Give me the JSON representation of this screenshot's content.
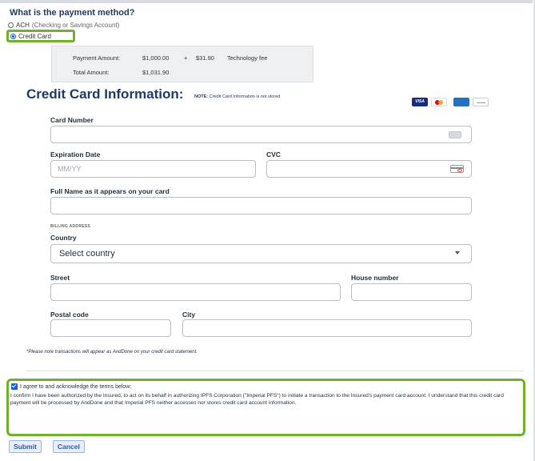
{
  "payment_method": {
    "question": "What is the payment method?",
    "ach_label": "ACH",
    "ach_sub": "(Checking or Savings Account)",
    "credit_card_label": "Credit Card",
    "selected": "Credit Card"
  },
  "payment_summary": {
    "payment_amount_label": "Payment Amount:",
    "payment_amount": "$1,000.00",
    "plus": "+",
    "fee_amount": "$31.90",
    "fee_label": "Technology fee",
    "total_label": "Total Amount:",
    "total_amount": "$1,031.90"
  },
  "credit_card": {
    "title": "Credit Card Information:",
    "note_prefix": "NOTE:",
    "note_text": "Credit Card Information is not stored",
    "card_brands": [
      "visa-logo",
      "mastercard-logo",
      "amex-logo",
      "discover-logo"
    ],
    "visa_text": "VISA"
  },
  "form": {
    "card_number_label": "Card Number",
    "card_number_value": "",
    "expiration_label": "Expiration Date",
    "expiration_placeholder": "MM/YY",
    "cvc_label": "CVC",
    "cvc_value": "",
    "full_name_label": "Full Name as it appears on your card",
    "full_name_value": "",
    "billing_heading": "BILLING ADDRESS",
    "country_label": "Country",
    "country_value": "Select country",
    "street_label": "Street",
    "house_number_label": "House number",
    "postal_code_label": "Postal code",
    "city_label": "City"
  },
  "disclaimer": "*Please note transactions will appear as AndDone on your credit card statement.",
  "terms": {
    "agree_label": "I agree to and acknowledge the terms below:",
    "agree_checked": true,
    "text": "I confirm I have been authorized by the Insured, to act on its behalf in authorizing IPFS Corporation (\"Imperial PFS\") to initiate a transaction to the Insured's payment card account. I understand that this credit card payment will be processed by AndDone and that Imperial PFS neither accesses nor stores credit card account information."
  },
  "actions": {
    "submit_label": "Submit",
    "cancel_label": "Cancel"
  },
  "colors": {
    "highlight_green": "#6fb12b",
    "heading_navy": "#1f3a63",
    "link_blue": "#2a5aa8"
  }
}
